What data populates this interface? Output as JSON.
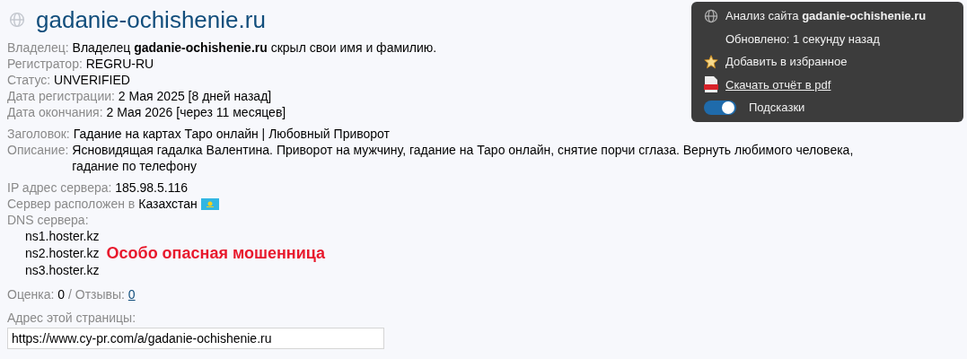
{
  "site": {
    "title": "gadanie-ochishenie.ru"
  },
  "whois": [
    {
      "label": "Владелец:",
      "value": "Владелец **gadanie-ochishenie.ru** скрыл свои имя и фамилию."
    },
    {
      "label": "Регистратор:",
      "value": "REGRU-RU"
    },
    {
      "label": "Статус:",
      "value": "UNVERIFIED"
    },
    {
      "label": "Дата регистрации:",
      "value": "2 Мая 2025 [8 дней назад]"
    },
    {
      "label": "Дата окончания:",
      "value": "2 Мая 2026 [через 11 месяцев]"
    }
  ],
  "meta": [
    {
      "label": "Заголовок:",
      "value": "Гадание на картах Таро онлайн | Любовный Приворот"
    },
    {
      "label": "Описание:",
      "value": "Ясновидящая гадалка Валентина. Приворот на мужчину, гадание на Таро онлайн, снятие порчи сглаза. Вернуть любимого человека, гадание по телефону"
    }
  ],
  "server": {
    "ip_label": "IP адрес сервера:",
    "ip": "185.98.5.116",
    "location_label": "Сервер расположен в",
    "country": "Казахстан",
    "dns_label": "DNS сервера:",
    "dns": [
      {
        "host": "ns1.hoster.kz"
      },
      {
        "host": "ns2.hoster.kz",
        "note": "Особо опасная мошенница"
      },
      {
        "host": "ns3.hoster.kz"
      }
    ]
  },
  "rating": {
    "score_label": "Оценка:",
    "score": "0",
    "separator": "/",
    "reviews_label": "Отзывы:",
    "reviews": "0"
  },
  "page_address": {
    "label": "Адрес этой страницы:",
    "value": "https://www.cy-pr.com/a/gadanie-ochishenie.ru"
  },
  "panel": {
    "title": "Анализ сайта **gadanie-ochishenie.ru**",
    "updated": "Обновлено: 1 секунду назад",
    "favorite": "Добавить в избранное",
    "download": "Скачать отчёт в pdf",
    "hints": {
      "label": "Подсказки",
      "on": true
    }
  }
}
